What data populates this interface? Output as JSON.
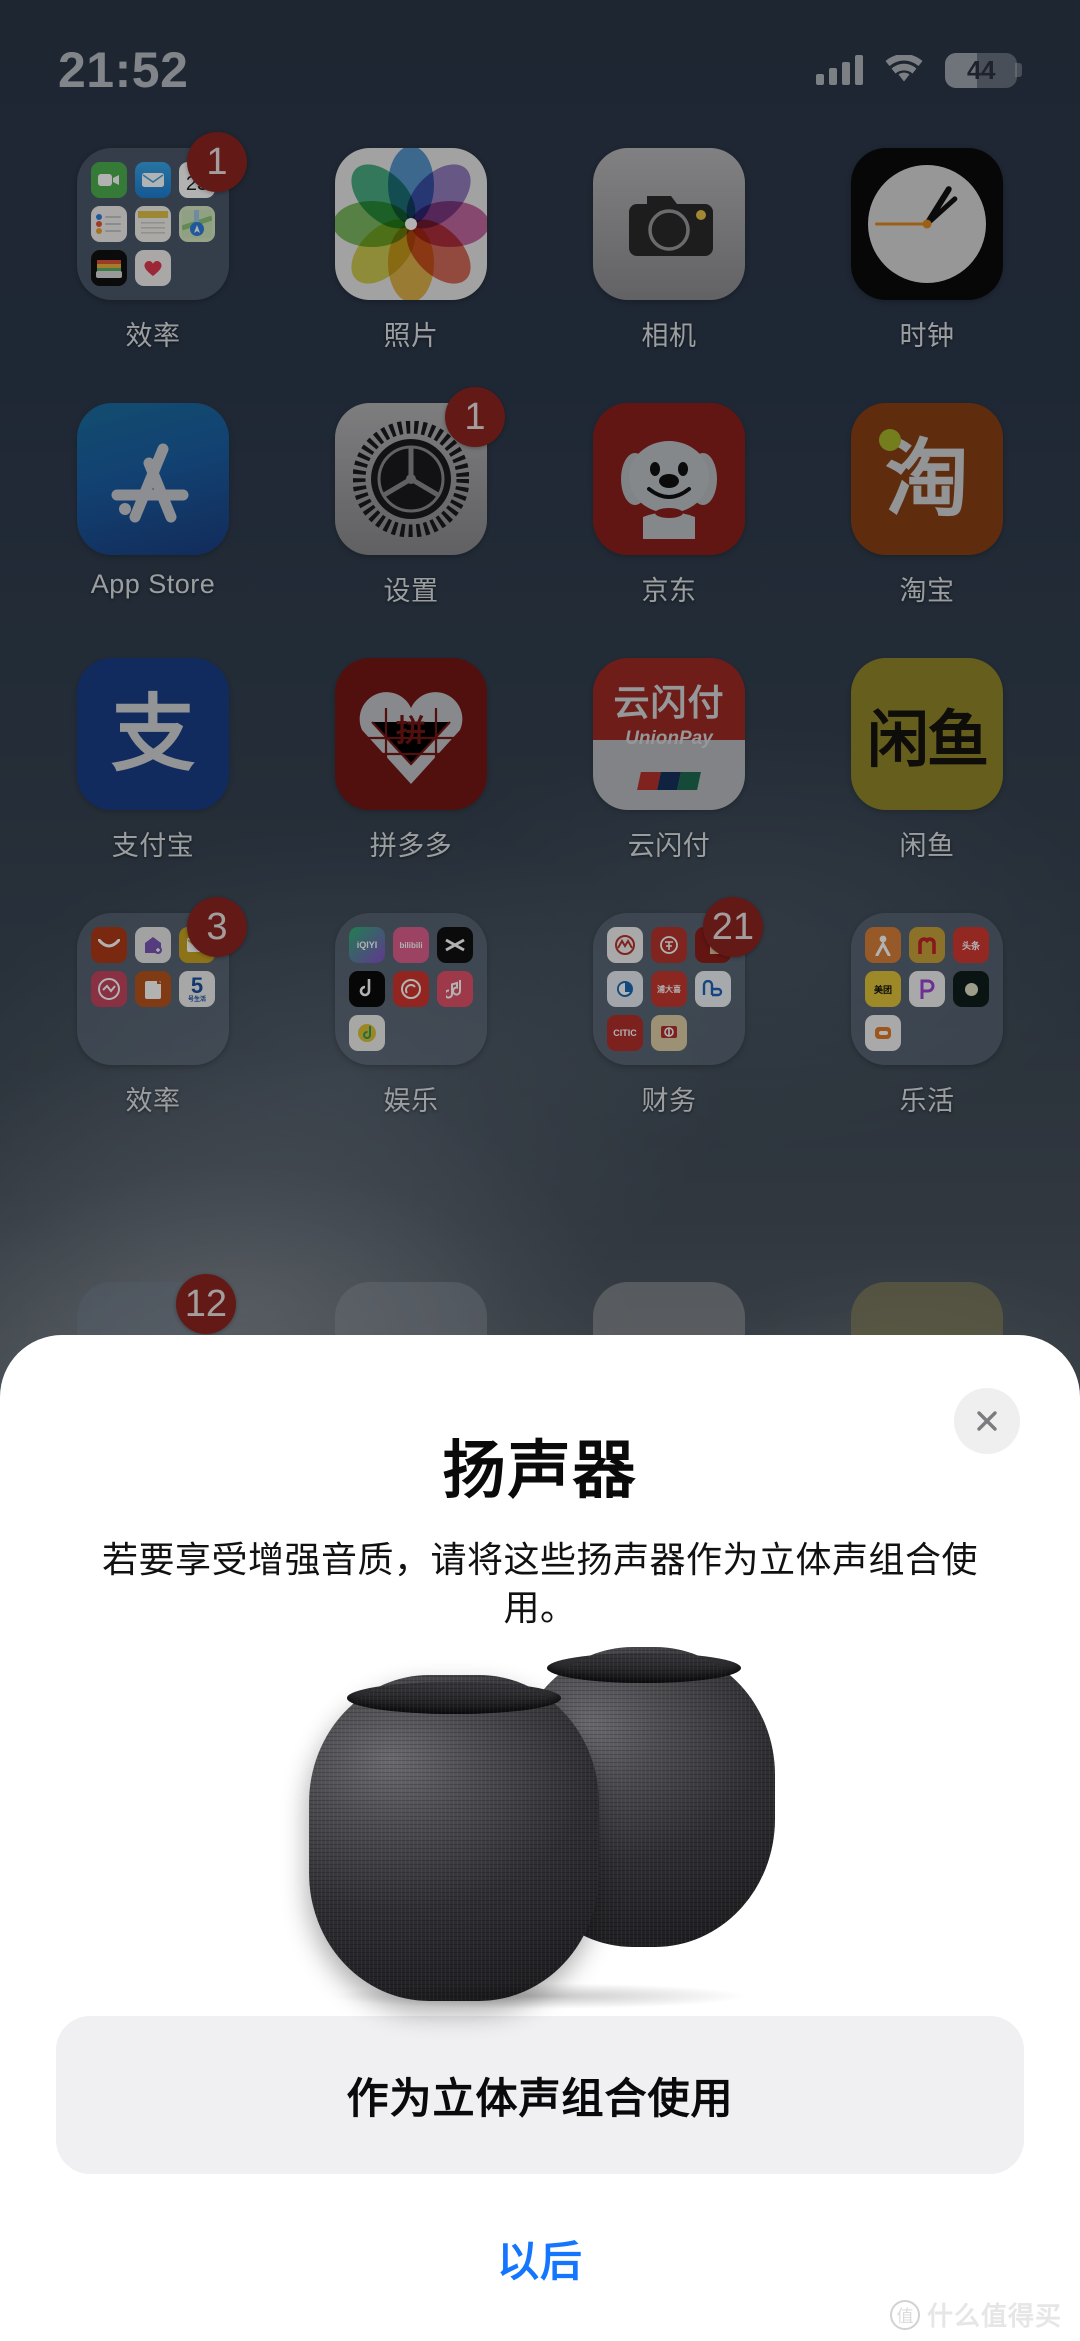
{
  "status_bar": {
    "time": "21:52",
    "battery_percent": "44",
    "signal_icon": "cellular-signal-icon",
    "wifi_icon": "wifi-icon",
    "battery_icon": "battery-icon"
  },
  "home_screen": {
    "apps": [
      {
        "label": "效率",
        "type": "folder",
        "badge": "1",
        "icon": "productivity-folder"
      },
      {
        "label": "照片",
        "type": "app",
        "badge": "",
        "icon": "photos-icon"
      },
      {
        "label": "相机",
        "type": "app",
        "badge": "",
        "icon": "camera-icon"
      },
      {
        "label": "时钟",
        "type": "app",
        "badge": "",
        "icon": "clock-icon"
      },
      {
        "label": "App Store",
        "type": "app",
        "badge": "",
        "icon": "app-store-icon"
      },
      {
        "label": "设置",
        "type": "app",
        "badge": "1",
        "icon": "settings-gear-icon"
      },
      {
        "label": "京东",
        "type": "app",
        "badge": "",
        "icon": "jd-dog-icon"
      },
      {
        "label": "淘宝",
        "type": "app",
        "badge": "",
        "icon": "taobao-icon",
        "glyph": "淘"
      },
      {
        "label": "支付宝",
        "type": "app",
        "badge": "",
        "icon": "alipay-icon",
        "glyph": "支"
      },
      {
        "label": "拼多多",
        "type": "app",
        "badge": "",
        "icon": "pinduoduo-icon",
        "glyph": "拼"
      },
      {
        "label": "云闪付",
        "type": "app",
        "badge": "",
        "icon": "unionpay-icon",
        "glyph": "云闪付",
        "sub": "UnionPay"
      },
      {
        "label": "闲鱼",
        "type": "app",
        "badge": "",
        "icon": "xianyu-icon",
        "glyph": "闲鱼"
      },
      {
        "label": "效率",
        "type": "folder",
        "badge": "3",
        "icon": "productivity-folder-2"
      },
      {
        "label": "娱乐",
        "type": "folder",
        "badge": "",
        "icon": "entertainment-folder"
      },
      {
        "label": "财务",
        "type": "folder",
        "badge": "21",
        "icon": "finance-folder"
      },
      {
        "label": "乐活",
        "type": "folder",
        "badge": "",
        "icon": "lifestyle-folder"
      }
    ],
    "partial_row": {
      "badge": "12"
    }
  },
  "modal": {
    "title": "扬声器",
    "description": "若要享受增强音质，请将这些扬声器作为立体声组合使用。",
    "hero_image": "homepod-stereo-pair-image",
    "primary_button": "作为立体声组合使用",
    "secondary_button": "以后",
    "close_icon": "close-icon"
  },
  "watermark": {
    "mark": "值",
    "text": "什么值得买"
  },
  "colors": {
    "accent_blue": "#1476ff",
    "badge_red": "#8f2420",
    "sheet_bg": "#ffffff",
    "button_bg": "#f0f0f3"
  }
}
